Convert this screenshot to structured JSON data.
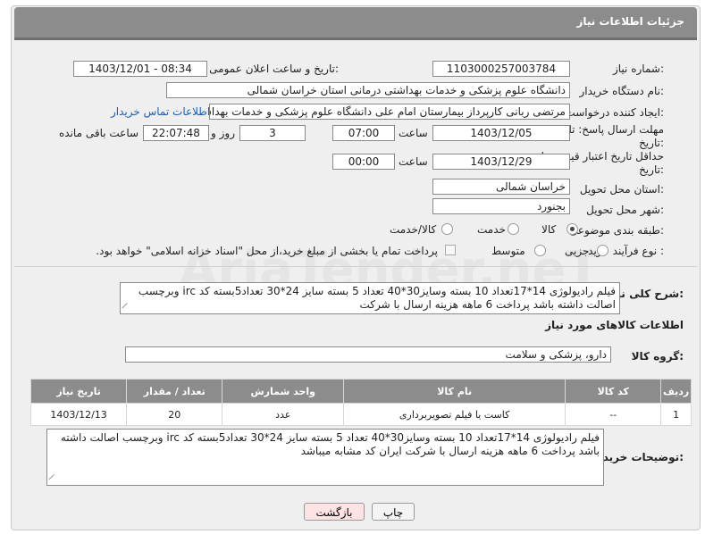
{
  "header": {
    "title": "جزئیات اطلاعات نیاز"
  },
  "fields": {
    "need_number_label": "شماره نیاز:",
    "need_number": "1103000257003784",
    "announce_label": "تاریخ و ساعت اعلان عمومی:",
    "announce_value": "1403/12/01 - 08:34",
    "buyer_label": "نام دستگاه خریدار:",
    "buyer_value": "دانشگاه علوم پزشکی و خدمات بهداشتی درمانی استان خراسان شمالی",
    "creator_label": "ایجاد کننده درخواست:",
    "creator_value": "مرتضی ربانی کارپرداز بیمارستان امام علی دانشگاه علوم پزشکی و خدمات بهداشتی",
    "contact_link": "اطلاعات تماس خریدار",
    "deadline_label_1": "مهلت ارسال پاسخ: تا",
    "deadline_label_2": "تاریخ:",
    "deadline_date": "1403/12/05",
    "time_label": "ساعت",
    "deadline_time": "07:00",
    "days_value": "3",
    "days_label": "روز و",
    "remaining_time": "22:07:48",
    "remaining_label": "ساعت باقی مانده",
    "validity_label_1": "حداقل تاریخ اعتبار قیمت: تا",
    "validity_label_2": "تاریخ:",
    "validity_date": "1403/12/29",
    "validity_time": "00:00",
    "province_label": "استان محل تحویل:",
    "province_value": "خراسان شمالی",
    "city_label": "شهر محل تحویل:",
    "city_value": "بجنورد",
    "category_label": "طبقه بندی موضوعی:",
    "category_options": [
      "کالا",
      "خدمت",
      "کالا/خدمت"
    ],
    "process_label": "نوع فرآیند خرید :",
    "process_options": [
      "جزیی",
      "متوسط"
    ],
    "payment_note": "پرداخت تمام یا بخشی از مبلغ خرید،از محل \"اسناد خزانه اسلامی\" خواهد بود."
  },
  "description": {
    "label": "شرح کلی نیاز:",
    "text": "فیلم رادیولوژی 14*17تعداد 10 بسته وسایز30*40 تعداد 5 بسته  سایز 24*30 تعداد5بسته کد irc وبرچسب اصالت داشته باشد پرداخت 6 ماهه هزینه ارسال با شرکت"
  },
  "goods_section": {
    "title": "اطلاعات کالاهای مورد نیاز",
    "group_label": "گروه کالا:",
    "group_value": "دارو، پزشکی و سلامت"
  },
  "table": {
    "headers": [
      "ردیف",
      "کد کالا",
      "نام کالا",
      "واحد شمارش",
      "تعداد / مقدار",
      "تاریخ نیاز"
    ],
    "rows": [
      [
        "1",
        "--",
        "کاست یا فیلم تصویربرداری",
        "عدد",
        "20",
        "1403/12/13"
      ]
    ]
  },
  "buyer_notes": {
    "label": "توضیحات خریدار:",
    "text": "فیلم رادیولوژی 14*17تعداد 10 بسته وسایز30*40 تعداد 5 بسته  سایز 24*30 تعداد5بسته کد irc وبرچسب اصالت داشته باشد پرداخت 6 ماهه هزینه ارسال با شرکت ایران کد مشابه میباشد"
  },
  "buttons": {
    "print": "چاپ",
    "back": "بازگشت"
  },
  "colors": {
    "header_bg": "#8c8c8c",
    "link": "#1a5fb4",
    "back_button_bg": "#fde3e3"
  }
}
